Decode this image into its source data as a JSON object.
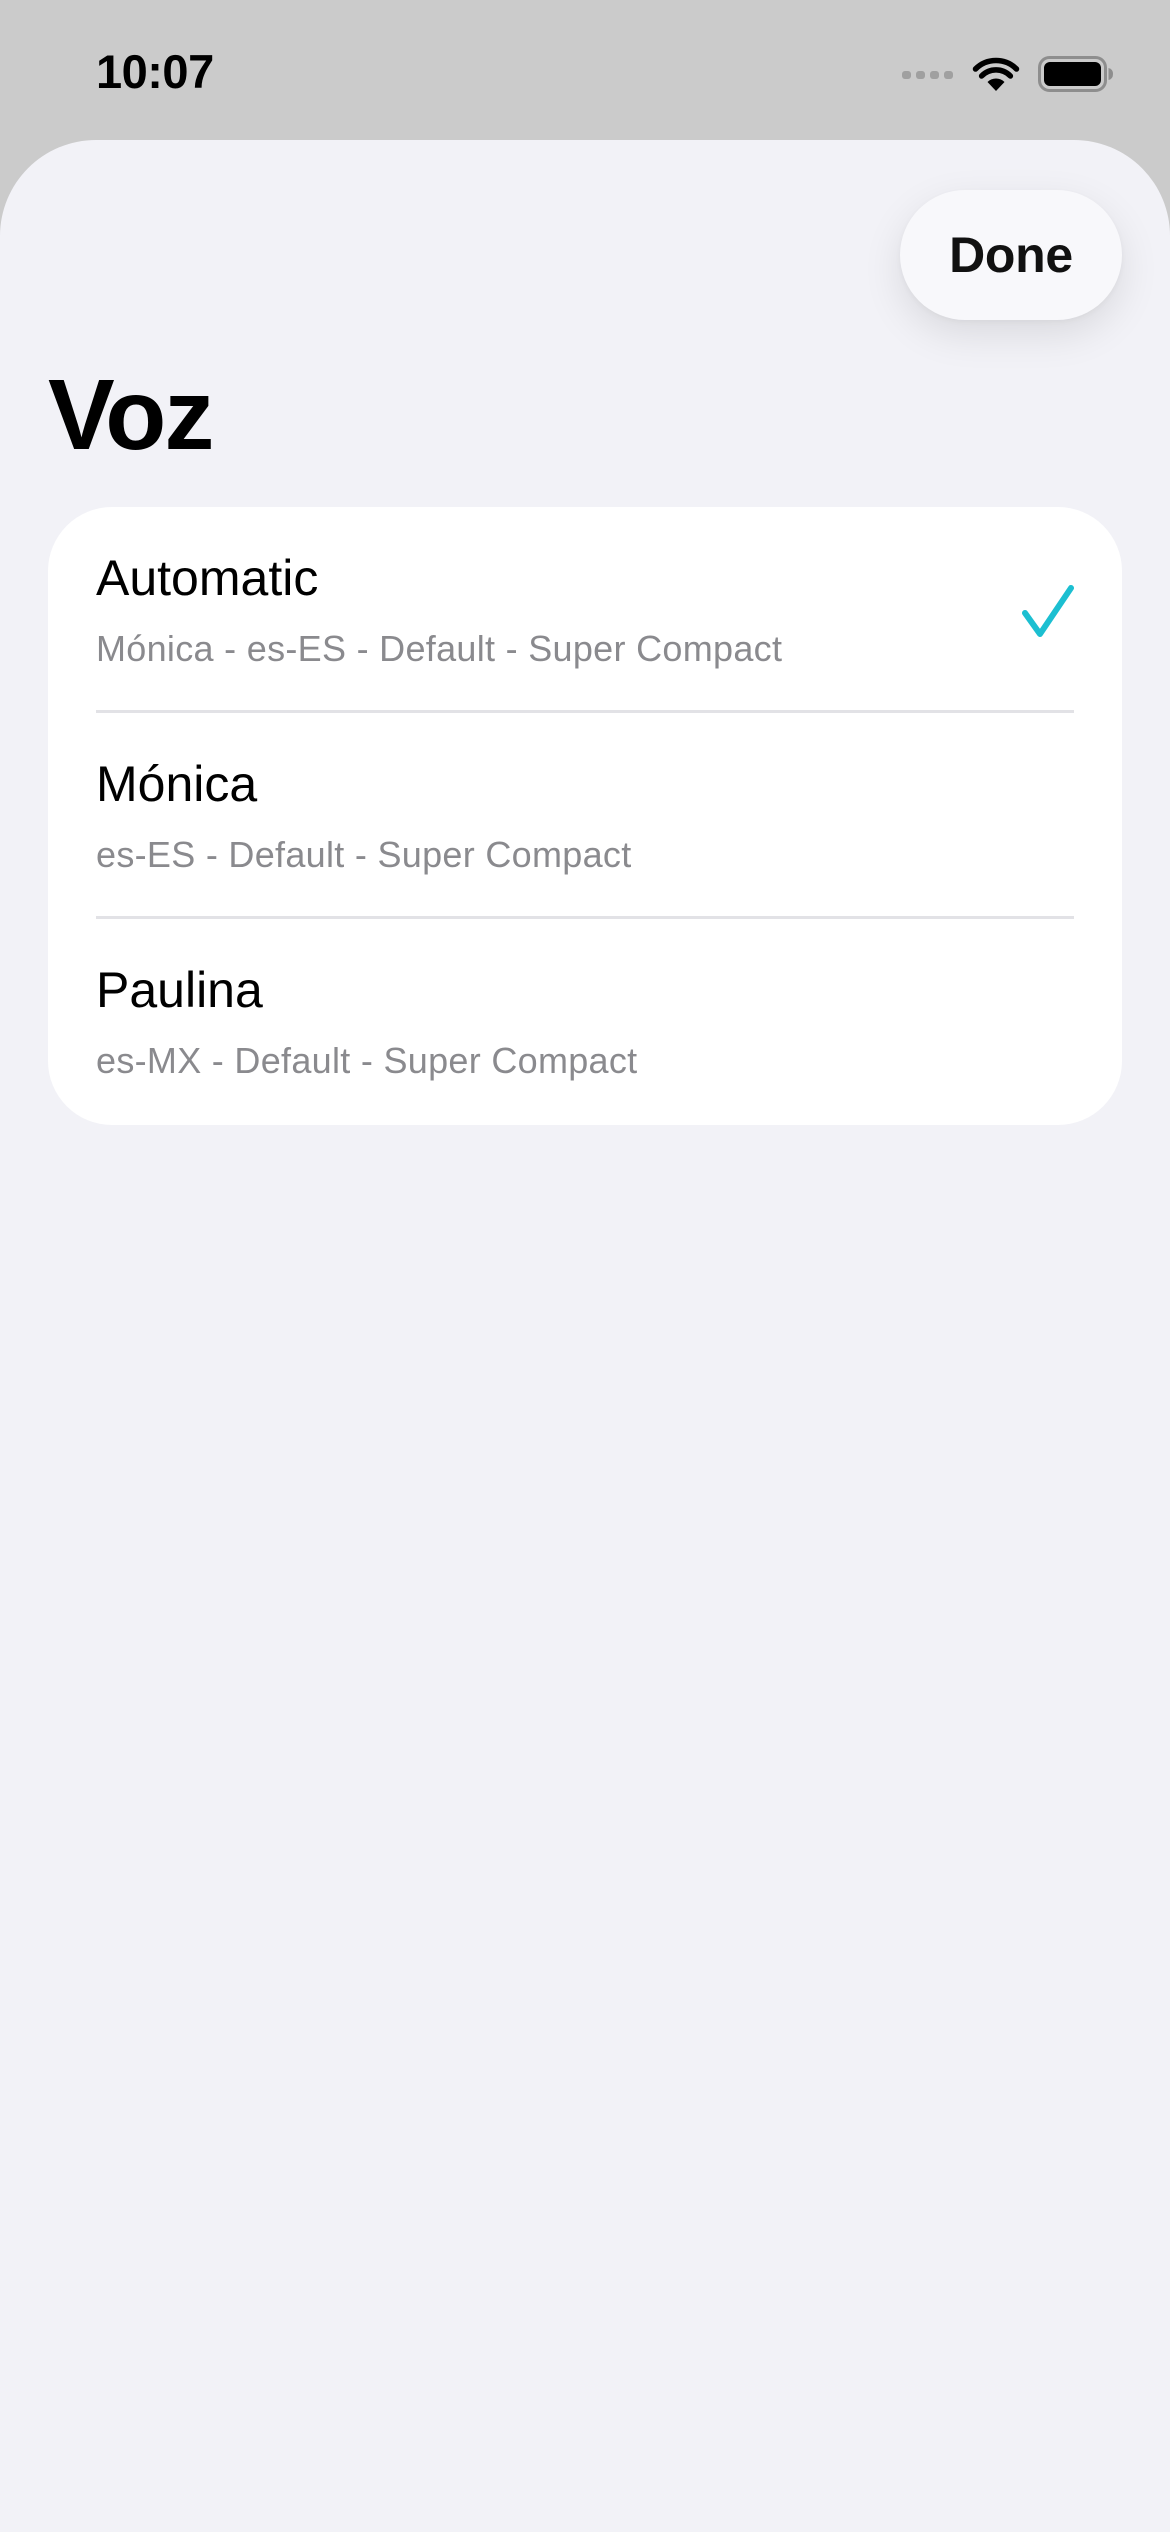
{
  "status_bar": {
    "time": "10:07",
    "icons": [
      "cellular-signal-icon",
      "wifi-icon",
      "battery-icon"
    ]
  },
  "header": {
    "done_label": "Done",
    "title": "Voz"
  },
  "voices": [
    {
      "name": "Automatic",
      "detail": "Mónica - es-ES - Default - Super Compact",
      "selected": true
    },
    {
      "name": "Mónica",
      "detail": "es-ES - Default - Super Compact",
      "selected": false
    },
    {
      "name": "Paulina",
      "detail": "es-MX - Default - Super Compact",
      "selected": false
    }
  ],
  "colors": {
    "accent": "#1cbfd1",
    "sheet_background": "#f2f2f7",
    "secondary_text": "#8a8a8e"
  }
}
